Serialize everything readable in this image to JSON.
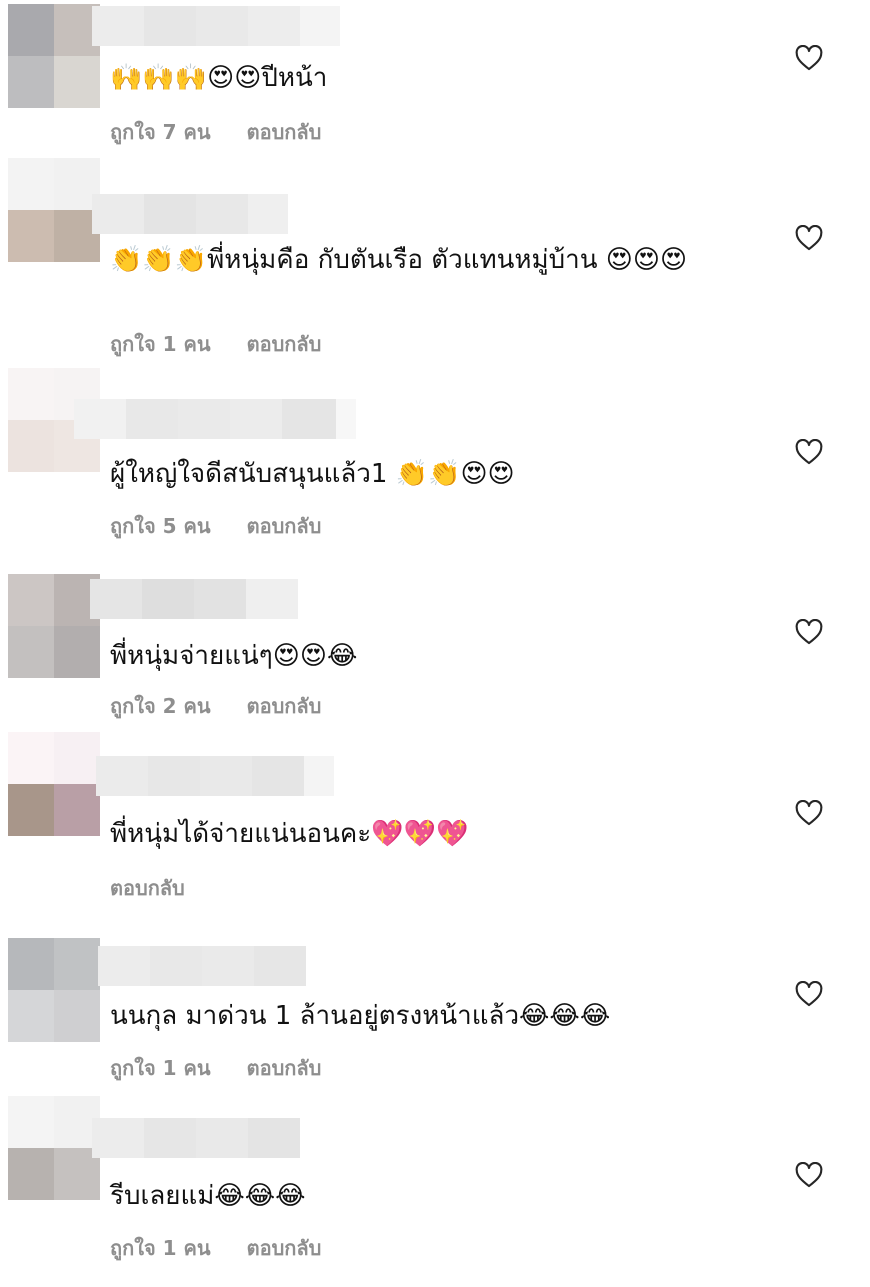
{
  "comments": [
    {
      "text": "🙌🙌🙌😍😍ปีหน้า",
      "likes": "ถูกใจ 7 คน",
      "reply": "ตอบกลับ"
    },
    {
      "text": "👏👏👏พี่หนุ่มคือ กับตันเรือ ตัวแทนหมู่บ้าน 😍😍😍",
      "likes": "ถูกใจ 1 คน",
      "reply": "ตอบกลับ"
    },
    {
      "text": "ผู้ใหญ่ใจดีสนับสนุนแล้ว1 👏👏😍😍",
      "likes": "ถูกใจ 5 คน",
      "reply": "ตอบกลับ"
    },
    {
      "text": "พี่หนุ่มจ่ายแน่ๆ😍😍😂",
      "likes": "ถูกใจ 2 คน",
      "reply": "ตอบกลับ"
    },
    {
      "text": "พี่หนุ่มได้จ่ายแน่นอนคะ💖💖💖",
      "reply": "ตอบกลับ"
    },
    {
      "text": "นนกุล มาด่วน 1 ล้านอยู่ตรงหน้าแล้ว😂😂😂",
      "likes": "ถูกใจ 1 คน",
      "reply": "ตอบกลับ"
    },
    {
      "text": "รีบเลยแม่😂😂😂",
      "likes": "ถูกใจ 1 คน",
      "reply": "ตอบกลับ"
    }
  ],
  "icons": {
    "like": "heart-outline-icon"
  },
  "colors": {
    "text": "#111111",
    "meta": "#8e8e8e",
    "heart": "#262626",
    "background": "#ffffff"
  }
}
